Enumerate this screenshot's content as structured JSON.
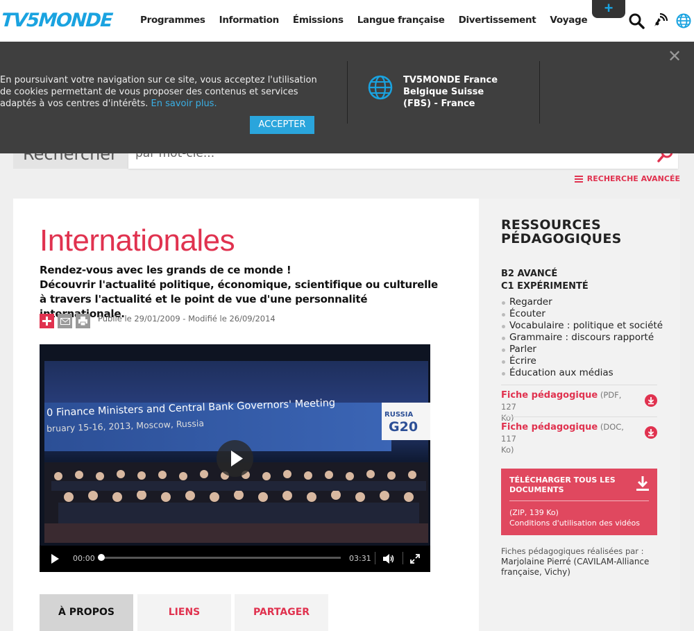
{
  "header": {
    "logo": "TV5MONDE",
    "nav": [
      "Programmes",
      "Information",
      "Émissions",
      "Langue française",
      "Divertissement",
      "Voyage"
    ],
    "plus_label": "+"
  },
  "cookie": {
    "text": "En poursuivant votre navigation sur ce site, vous acceptez l'utilisation de cookies permettant de vous proposer des contenus et services adaptés à vos centres d'intérêts.",
    "more_link": "En savoir plus.",
    "accept_label": "ACCEPTER",
    "region": "TV5MONDE France Belgique Suisse (FBS) - France",
    "close": "✕"
  },
  "search": {
    "label": "Rechercher",
    "placeholder": "par mot-clé...",
    "advanced_label": "RECHERCHE AVANCÉE"
  },
  "article": {
    "title": "Internationales",
    "intro_1": "Rendez-vous avec les grands de ce monde !",
    "intro_2": "Découvrir l'actualité politique, économique, scientifique ou culturelle à travers l'actualité et le point de vue d'une personnalité internationale.",
    "published": "Publié le 29/01/2009 - Modifié le 26/09/2014",
    "share_colors": {
      "plus": "#e0324f",
      "mail": "#9a9a9a",
      "print": "#9a9a9a"
    }
  },
  "video": {
    "banner_line1": "0 Finance Ministers and Central Bank Governors' Meeting",
    "banner_line2": "bruary 15-16, 2013, Moscow, Russia",
    "logo_top": "RUSSIA",
    "logo_bottom": "G20",
    "current_time": "00:00",
    "duration": "03:31",
    "progress": 0
  },
  "tabs": [
    {
      "label": "À PROPOS",
      "active": true
    },
    {
      "label": "LIENS",
      "active": false
    },
    {
      "label": "PARTAGER",
      "active": false
    }
  ],
  "sidebar": {
    "title_line1": "RESSOURCES",
    "title_line2": "PÉDAGOGIQUES",
    "level1": "B2 AVANCÉ",
    "level2": "C1 EXPÉRIMENTÉ",
    "items": [
      "Regarder",
      "Écouter",
      "Vocabulaire : politique et société",
      "Grammaire : discours rapporté",
      "Parler",
      "Écrire",
      "Éducation aux médias"
    ],
    "fiches": [
      {
        "label": "Fiche pédagogique",
        "meta_1": "(PDF, 127",
        "meta_2": "Ko)"
      },
      {
        "label": "Fiche pédagogique",
        "meta_1": "(DOC, 117",
        "meta_2": "Ko)"
      }
    ],
    "download": {
      "title": "TÉLÉCHARGER TOUS LES DOCUMENTS",
      "size": "(ZIP, 139 Ko)",
      "conditions": "Conditions d'utilisation des vidéos"
    },
    "credit_label": "Fiches pédagogiques réalisées par :",
    "credit_name": "Marjolaine Pierré (CAVILAM-Alliance française, Vichy)"
  },
  "colors": {
    "accent": "#e0324f",
    "brand_blue": "#1aa3e0",
    "cookie_bg": "#3f3f3f"
  }
}
